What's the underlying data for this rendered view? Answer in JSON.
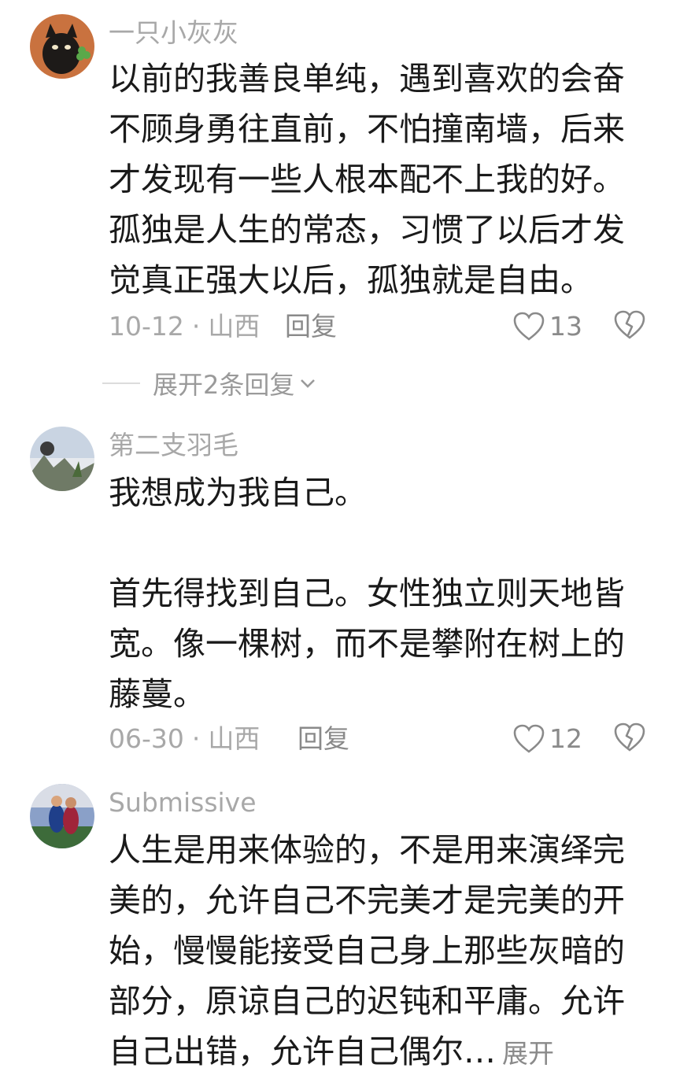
{
  "colors": {
    "meta_text": "#a8a8a8",
    "body_text": "#1a1a1a",
    "icon_stroke": "#8a8a8a"
  },
  "comments": [
    {
      "username": "一只小灰灰",
      "avatar_icon": "black-cat-avatar",
      "paragraphs": [
        "以前的我善良单纯，遇到喜欢的会奋不顾身勇往直前，不怕撞南墙，后来才发现有一些人根本配不上我的好。孤独是人生的常态，习惯了以后才发觉真正强大以后，孤独就是自由。"
      ],
      "date": "10-12",
      "separator": "·",
      "region": "山西",
      "reply_label": "回复",
      "like_count": "13",
      "expand_replies_label": "展开2条回复"
    },
    {
      "username": "第二支羽毛",
      "avatar_icon": "landscape-avatar",
      "paragraphs": [
        "我想成为我自己。",
        "首先得找到自己。女性独立则天地皆宽。像一棵树，而不是攀附在树上的藤蔓。"
      ],
      "date": "06-30",
      "separator": "·",
      "region": "山西",
      "reply_label": "回复",
      "like_count": "12"
    },
    {
      "username": "Submissive",
      "avatar_icon": "sports-photo-avatar",
      "paragraphs": [
        "人生是用来体验的，不是用来演绎完美的，允许自己不完美才是完美的开始，慢慢能接受自己身上那些灰暗的部分，原谅自己的迟钝和平庸。允许自己出错，允许自己偶尔…"
      ],
      "more_label": "展开"
    }
  ]
}
